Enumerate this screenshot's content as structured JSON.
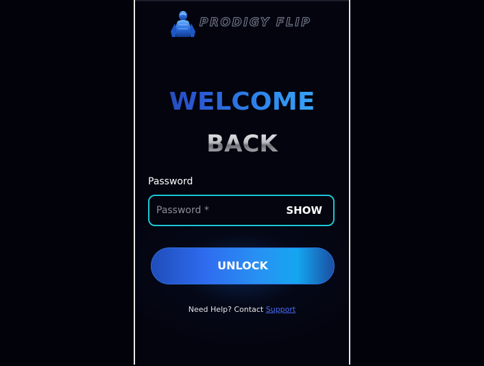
{
  "brand": {
    "name": "PRODIGY FLIP",
    "logo_icon": "humanoid-figure-icon"
  },
  "heading": {
    "line1": "WELCOME",
    "line2": "BACK"
  },
  "form": {
    "password_label": "Password",
    "password_placeholder": "Password *",
    "password_value": "",
    "show_label": "SHOW",
    "submit_label": "UNLOCK"
  },
  "help": {
    "prefix": "Need Help? Contact ",
    "link_label": "Support"
  },
  "colors": {
    "field_border": "#19c8d9",
    "button_gradient_start": "#1f4dba",
    "button_gradient_end": "#14a6f0",
    "link": "#4b6cf7",
    "background": "#03040e"
  }
}
